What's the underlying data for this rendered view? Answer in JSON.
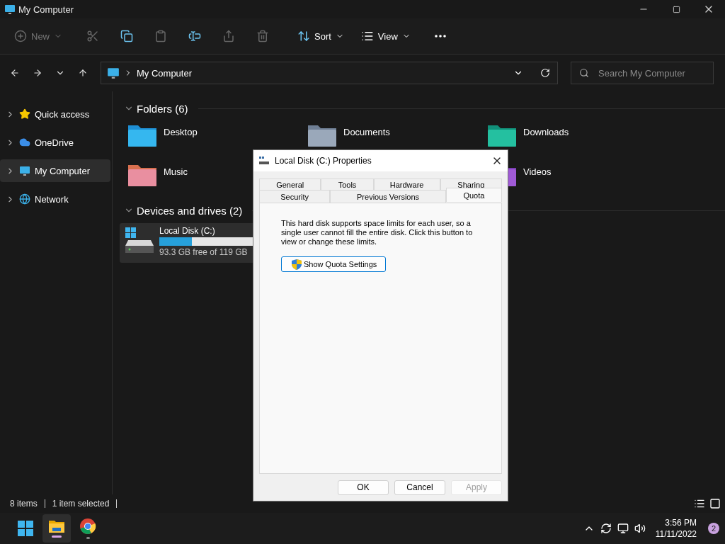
{
  "window": {
    "title": "My Computer"
  },
  "toolbar": {
    "items": [
      {
        "kind": "new",
        "label": "New",
        "disabled": true
      },
      {
        "kind": "cut",
        "disabled": true
      },
      {
        "kind": "copy",
        "disabled": false
      },
      {
        "kind": "paste",
        "disabled": true
      },
      {
        "kind": "rename",
        "disabled": false
      },
      {
        "kind": "share",
        "disabled": true
      },
      {
        "kind": "delete",
        "disabled": true
      },
      {
        "kind": "sort",
        "label": "Sort",
        "disabled": false
      },
      {
        "kind": "view",
        "label": "View",
        "disabled": false
      },
      {
        "kind": "more",
        "disabled": false
      }
    ]
  },
  "address": {
    "path": "My Computer"
  },
  "search": {
    "placeholder": "Search My Computer"
  },
  "sidebar": {
    "items": [
      {
        "kind": "star",
        "label": "Quick access",
        "selected": false
      },
      {
        "kind": "cloud",
        "label": "OneDrive",
        "selected": false
      },
      {
        "kind": "pc",
        "label": "My Computer",
        "selected": true
      },
      {
        "kind": "network",
        "label": "Network",
        "selected": false
      }
    ]
  },
  "folders": {
    "heading": "Folders (6)",
    "items": [
      {
        "kind": "desktop",
        "label": "Desktop"
      },
      {
        "kind": "documents",
        "label": "Documents"
      },
      {
        "kind": "downloads",
        "label": "Downloads"
      },
      {
        "kind": "music",
        "label": "Music"
      },
      {
        "kind": "videos",
        "label": "Videos"
      }
    ]
  },
  "drives": {
    "heading": "Devices and drives (2)",
    "items": [
      {
        "label": "Local Disk (C:)",
        "level": 0.22,
        "free": "93.3 GB free of 119 GB",
        "selected": true
      }
    ]
  },
  "status_bar": {
    "items": [
      "8 items",
      "1 item selected"
    ]
  },
  "dialog": {
    "title": "Local Disk (C:) Properties",
    "tab_rows": [
      [
        {
          "label": "General",
          "selected": false
        },
        {
          "label": "Tools",
          "selected": false
        },
        {
          "label": "Hardware",
          "selected": false
        },
        {
          "label": "Sharing",
          "selected": false
        }
      ],
      [
        {
          "label": "Security",
          "selected": false
        },
        {
          "label": "Previous Versions",
          "selected": false
        },
        {
          "label": "Quota",
          "selected": true
        }
      ]
    ],
    "message": "This hard disk supports space limits for each user, so a single user cannot fill the entire disk. Click this button to view or change these limits.",
    "action": "Show Quota Settings",
    "buttons": [
      {
        "label": "OK",
        "disabled": false
      },
      {
        "label": "Cancel",
        "disabled": false
      },
      {
        "label": "Apply",
        "disabled": true
      }
    ]
  },
  "taskbar": {
    "apps": [
      {
        "kind": "start",
        "active": false
      },
      {
        "kind": "explorer",
        "active": true
      },
      {
        "kind": "browser",
        "active": false
      }
    ],
    "time": "3:56 PM",
    "date": "11/11/2022",
    "notifications": "2"
  }
}
